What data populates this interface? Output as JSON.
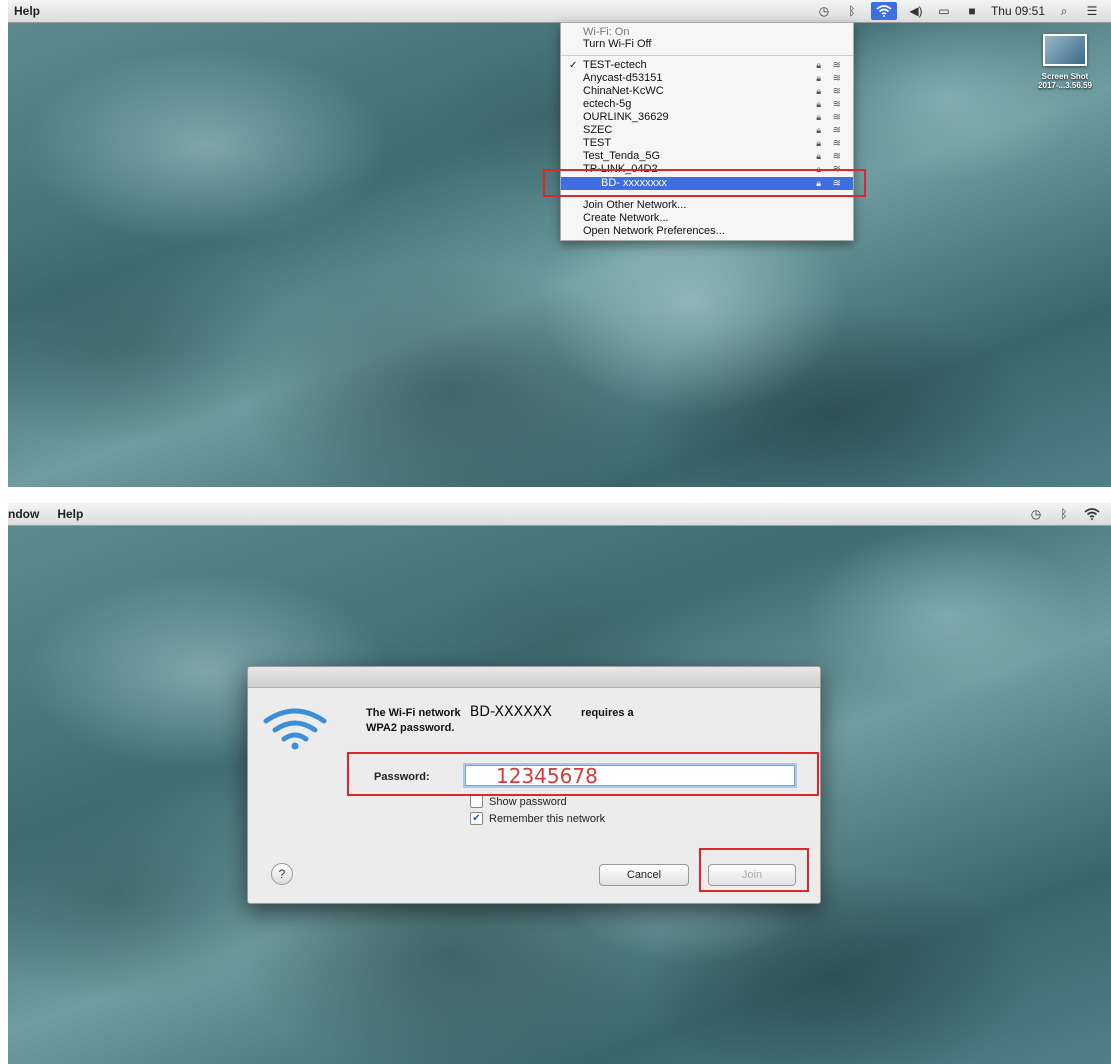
{
  "top_screen": {
    "menubar": {
      "app_menus": [
        "Help"
      ],
      "status_icons": [
        "time-machine-icon",
        "bluetooth-icon",
        "wifi-icon",
        "volume-icon",
        "battery-icon",
        "display-icon"
      ],
      "clock": "Thu 09:51",
      "search_icon": "search-icon",
      "list_icon": "notification-center-icon"
    },
    "wifi_menu": {
      "status": "Wi-Fi: On",
      "toggle": "Turn Wi-Fi Off",
      "networks": [
        {
          "name": "TEST-ectech",
          "checked": true
        },
        {
          "name": "Anycast-d53151"
        },
        {
          "name": "ChinaNet-KcWC"
        },
        {
          "name": "ectech-5g"
        },
        {
          "name": "OURLINK_36629"
        },
        {
          "name": "SZEC"
        },
        {
          "name": "TEST"
        },
        {
          "name": "Test_Tenda_5G"
        },
        {
          "name": "TP-LINK_04D2"
        },
        {
          "name": "BD- xxxxxxxx",
          "selected": true
        }
      ],
      "actions": [
        "Join Other Network...",
        "Create Network...",
        "Open Network Preferences..."
      ]
    },
    "desktop_file": {
      "label_line1": "Screen Shot",
      "label_line2": "2017-...3.56.59"
    }
  },
  "bottom_screen": {
    "menubar": {
      "app_menus": [
        "ndow",
        "Help"
      ]
    },
    "dialog": {
      "message_prefix": "The Wi-Fi network",
      "ssid": "BD-XXXXXX",
      "message_suffix": "requires a",
      "message_line2": "WPA2 password.",
      "password_label": "Password:",
      "password_value": "12345678",
      "show_password": "Show password",
      "show_password_checked": false,
      "remember": "Remember this network",
      "remember_checked": true,
      "help": "?",
      "cancel": "Cancel",
      "join": "Join"
    }
  },
  "colors": {
    "highlight_red": "#e0262c",
    "selection_blue": "#3d6fe0",
    "password_red": "#d63a3a"
  }
}
